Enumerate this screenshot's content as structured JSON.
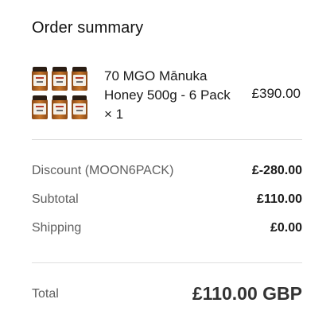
{
  "order_summary": {
    "title": "Order summary",
    "product": {
      "name": "70 MGO Mānuka Honey 500g - 6 Pack × 1",
      "price": "£390.00",
      "image_icon": "honey-jars-6-pack-image"
    },
    "discount": {
      "label": "Discount (MOON6PACK)",
      "value": "£-280.00"
    },
    "subtotal": {
      "label": "Subtotal",
      "value": "£110.00"
    },
    "shipping": {
      "label": "Shipping",
      "value": "£0.00"
    },
    "total": {
      "label": "Total",
      "value": "£110.00 GBP"
    }
  },
  "colors": {
    "background": "#ffffff",
    "text_primary": "#1a1a1a",
    "text_secondary": "#5f5f5f",
    "divider": "#dedede"
  }
}
